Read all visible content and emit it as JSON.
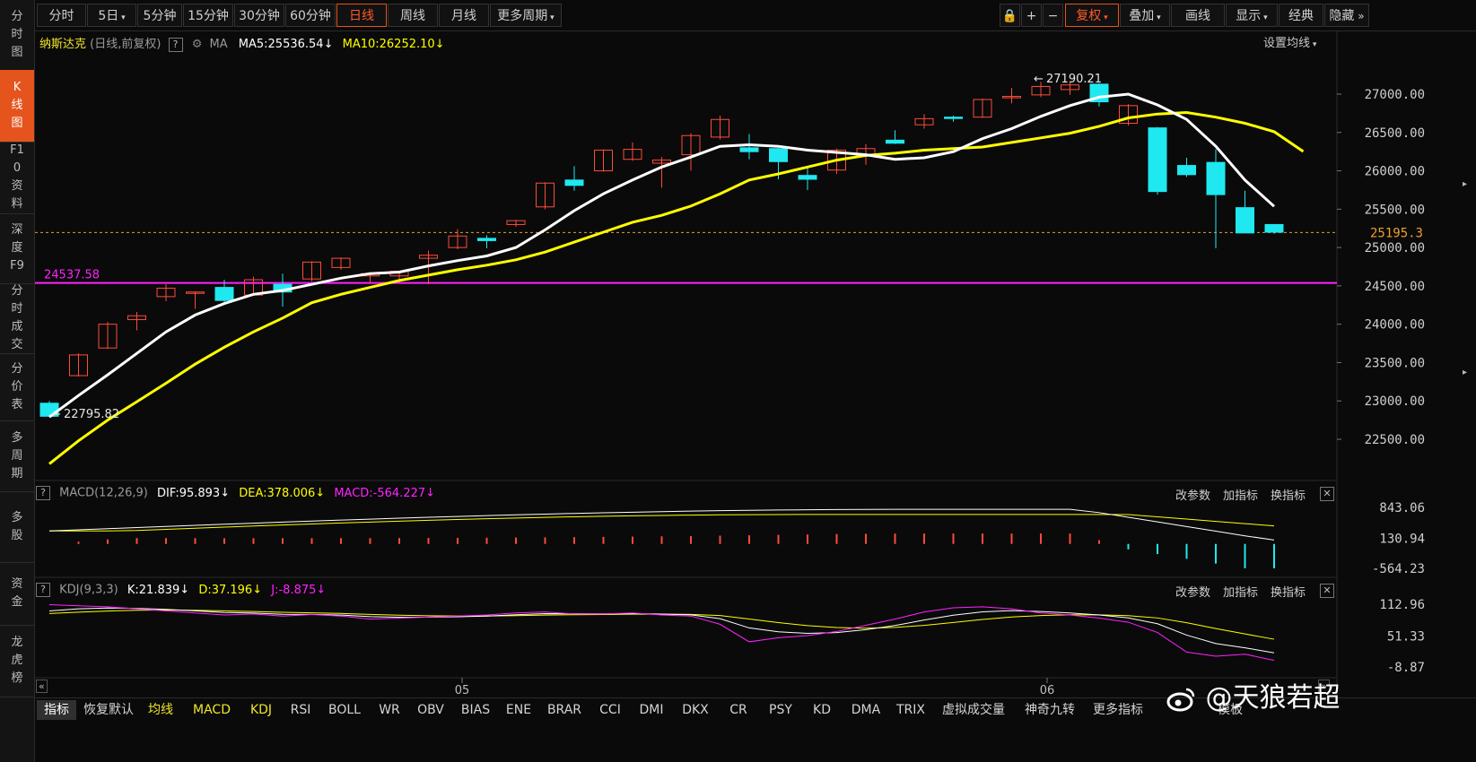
{
  "sidebar": {
    "items": [
      {
        "label": "分时图",
        "active": false
      },
      {
        "label": "K线图",
        "active": true
      },
      {
        "label": "F10资料",
        "active": false
      },
      {
        "label": "深度F9",
        "active": false
      },
      {
        "label": "分时成交",
        "active": false
      },
      {
        "label": "分价表",
        "active": false
      },
      {
        "label": "多周期",
        "active": false
      },
      {
        "label": "多股",
        "active": false
      },
      {
        "label": "资金",
        "active": false
      },
      {
        "label": "龙虎榜",
        "active": false
      }
    ]
  },
  "toolbar": {
    "periods": [
      "分时",
      "5日",
      "5分钟",
      "15分钟",
      "30分钟",
      "60分钟",
      "日线",
      "周线",
      "月线",
      "更多周期"
    ],
    "active_period": "日线",
    "right_buttons": [
      "复权",
      "叠加",
      "画线",
      "显示",
      "经典",
      "隐藏"
    ]
  },
  "main_chart": {
    "name": "纳斯达克",
    "subtitle": "(日线,前复权)",
    "ma_label": "MA",
    "ma5": "MA5:25536.54",
    "ma10": "MA10:26252.10",
    "setting_label": "设置均线",
    "high_marker": "27190.21",
    "low_marker": "22795.82",
    "hline_label": "24537.58",
    "current_price": "25195.3",
    "y_ticks": [
      "27000.00",
      "26500.00",
      "26000.00",
      "25500.00",
      "25000.00",
      "24500.00",
      "24000.00",
      "23500.00",
      "23000.00",
      "22500.00"
    ],
    "colors": {
      "up": "#ff4b3a",
      "down": "#1fe8f0",
      "ma5": "#ffffff",
      "ma10": "#ffff00",
      "hline": "#ff22ff"
    }
  },
  "macd": {
    "title": "MACD(12,26,9)",
    "dif": "DIF:95.893",
    "dea": "DEA:378.006",
    "macd": "MACD:-564.227",
    "links": [
      "改参数",
      "加指标",
      "换指标"
    ],
    "y_ticks": [
      "843.06",
      "130.94",
      "-564.23"
    ]
  },
  "kdj": {
    "title": "KDJ(9,3,3)",
    "k": "K:21.839",
    "d": "D:37.196",
    "j": "J:-8.875",
    "links": [
      "改参数",
      "加指标",
      "换指标"
    ],
    "y_ticks": [
      "112.96",
      "51.33",
      "-8.87"
    ]
  },
  "x_axis": {
    "labels": [
      "05",
      "06"
    ]
  },
  "bottom_tabs": [
    "指标",
    "恢复默认",
    "均线",
    "MACD",
    "KDJ",
    "RSI",
    "BOLL",
    "WR",
    "OBV",
    "BIAS",
    "ENE",
    "BRAR",
    "CCI",
    "DMI",
    "DKX",
    "CR",
    "PSY",
    "KD",
    "DMA",
    "TRIX",
    "虚拟成交量",
    "神奇九转",
    "更多指标",
    "模板"
  ],
  "watermark": "@天狼若超",
  "chart_data": {
    "type": "candlestick",
    "series_ohlc": [
      {
        "o": 22970,
        "h": 23000,
        "l": 22790,
        "c": 22800
      },
      {
        "o": 23330,
        "h": 23620,
        "l": 23320,
        "c": 23600
      },
      {
        "o": 23690,
        "h": 24030,
        "l": 23680,
        "c": 24000
      },
      {
        "o": 24060,
        "h": 24160,
        "l": 23920,
        "c": 24110
      },
      {
        "o": 24360,
        "h": 24520,
        "l": 24300,
        "c": 24470
      },
      {
        "o": 24420,
        "h": 24420,
        "l": 24200,
        "c": 24420
      },
      {
        "o": 24480,
        "h": 24580,
        "l": 24250,
        "c": 24310
      },
      {
        "o": 24380,
        "h": 24620,
        "l": 24370,
        "c": 24580
      },
      {
        "o": 24520,
        "h": 24660,
        "l": 24230,
        "c": 24420
      },
      {
        "o": 24590,
        "h": 24820,
        "l": 24560,
        "c": 24810
      },
      {
        "o": 24740,
        "h": 24870,
        "l": 24710,
        "c": 24860
      },
      {
        "o": 24630,
        "h": 24680,
        "l": 24550,
        "c": 24660
      },
      {
        "o": 24630,
        "h": 24690,
        "l": 24540,
        "c": 24690
      },
      {
        "o": 24860,
        "h": 24960,
        "l": 24520,
        "c": 24900
      },
      {
        "o": 25000,
        "h": 25240,
        "l": 24980,
        "c": 25150
      },
      {
        "o": 25120,
        "h": 25160,
        "l": 24990,
        "c": 25090
      },
      {
        "o": 25300,
        "h": 25360,
        "l": 25270,
        "c": 25350
      },
      {
        "o": 25530,
        "h": 25850,
        "l": 25500,
        "c": 25840
      },
      {
        "o": 25880,
        "h": 26060,
        "l": 25740,
        "c": 25810
      },
      {
        "o": 26000,
        "h": 26280,
        "l": 25990,
        "c": 26270
      },
      {
        "o": 26150,
        "h": 26370,
        "l": 26130,
        "c": 26280
      },
      {
        "o": 26100,
        "h": 26180,
        "l": 25780,
        "c": 26140
      },
      {
        "o": 26210,
        "h": 26490,
        "l": 26000,
        "c": 26460
      },
      {
        "o": 26440,
        "h": 26720,
        "l": 26410,
        "c": 26670
      },
      {
        "o": 26300,
        "h": 26480,
        "l": 26150,
        "c": 26250
      },
      {
        "o": 26290,
        "h": 26300,
        "l": 25890,
        "c": 26120
      },
      {
        "o": 25940,
        "h": 26040,
        "l": 25750,
        "c": 25890
      },
      {
        "o": 26010,
        "h": 26290,
        "l": 25960,
        "c": 26270
      },
      {
        "o": 26200,
        "h": 26350,
        "l": 26080,
        "c": 26290
      },
      {
        "o": 26400,
        "h": 26530,
        "l": 26350,
        "c": 26360
      },
      {
        "o": 26600,
        "h": 26740,
        "l": 26550,
        "c": 26680
      },
      {
        "o": 26700,
        "h": 26720,
        "l": 26640,
        "c": 26690
      },
      {
        "o": 26700,
        "h": 26940,
        "l": 26690,
        "c": 26930
      },
      {
        "o": 26960,
        "h": 27080,
        "l": 26880,
        "c": 26970
      },
      {
        "o": 26990,
        "h": 27160,
        "l": 26960,
        "c": 27100
      },
      {
        "o": 27060,
        "h": 27160,
        "l": 26990,
        "c": 27120
      },
      {
        "o": 27130,
        "h": 27140,
        "l": 26840,
        "c": 26900
      },
      {
        "o": 26620,
        "h": 26870,
        "l": 26590,
        "c": 26850
      },
      {
        "o": 26560,
        "h": 26570,
        "l": 25690,
        "c": 25730
      },
      {
        "o": 26070,
        "h": 26170,
        "l": 25920,
        "c": 25950
      },
      {
        "o": 26110,
        "h": 26280,
        "l": 24990,
        "c": 25690
      },
      {
        "o": 25520,
        "h": 25740,
        "l": 25190,
        "c": 25190
      },
      {
        "o": 25300,
        "h": 25300,
        "l": 25180,
        "c": 25200
      }
    ],
    "ma5": [
      22790,
      23070,
      23340,
      23620,
      23900,
      24120,
      24270,
      24390,
      24440,
      24520,
      24600,
      24660,
      24680,
      24760,
      24830,
      24890,
      25000,
      25230,
      25480,
      25700,
      25880,
      26050,
      26180,
      26320,
      26340,
      26320,
      26270,
      26240,
      26210,
      26150,
      26170,
      26250,
      26420,
      26550,
      26710,
      26850,
      26960,
      27000,
      26860,
      26670,
      26320,
      25880,
      25536.54
    ],
    "ma10": [
      22180,
      22480,
      22750,
      22990,
      23230,
      23480,
      23700,
      23900,
      24080,
      24280,
      24390,
      24480,
      24570,
      24640,
      24710,
      24770,
      24840,
      24940,
      25070,
      25200,
      25330,
      25420,
      25540,
      25700,
      25880,
      25960,
      26050,
      26140,
      26200,
      26230,
      26270,
      26290,
      26310,
      26370,
      26430,
      26490,
      26580,
      26690,
      26740,
      26760,
      26700,
      26620,
      26510,
      26252.1
    ],
    "y_range": [
      22000,
      27500
    ],
    "macd_range": [
      -564.23,
      843.06
    ],
    "kdj_range": [
      -8.87,
      112.96
    ]
  }
}
